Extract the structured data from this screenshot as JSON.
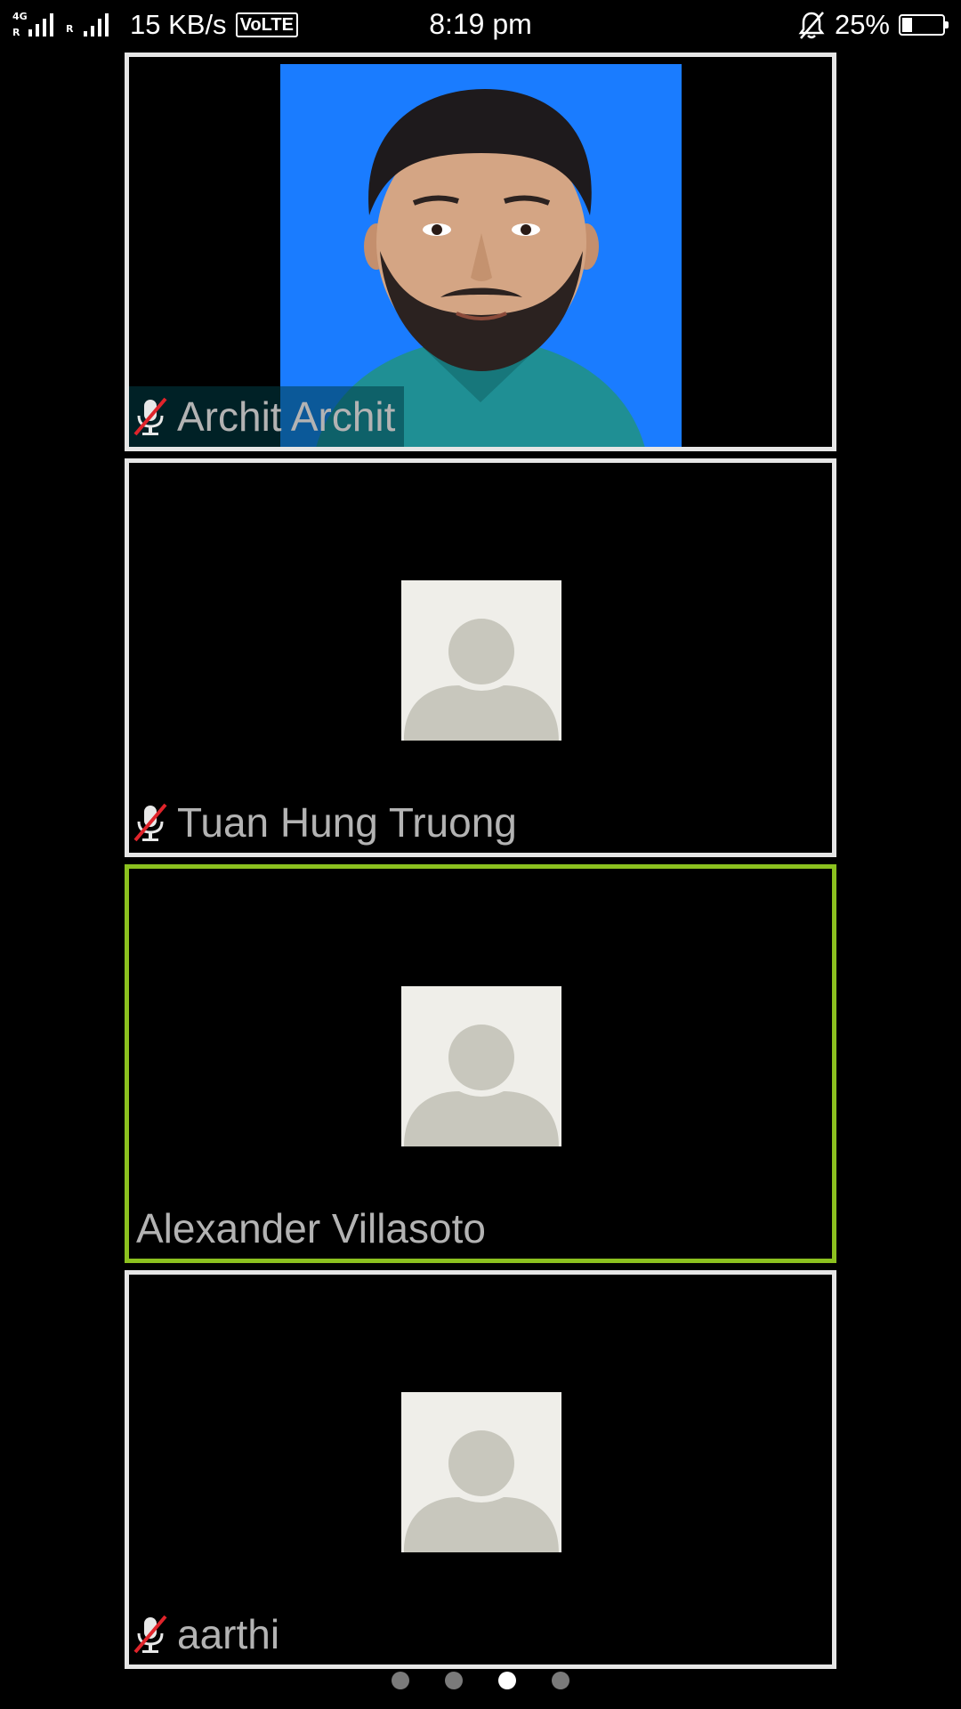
{
  "status_bar": {
    "network_type": "4G",
    "roaming_tag_1": "R",
    "roaming_tag_2": "R",
    "data_speed": "15 KB/s",
    "volte_label": "VoLTE",
    "time": "8:19 pm",
    "notifications_muted_icon": "bell-off-icon",
    "battery_percent": "25%",
    "battery_level": 0.25
  },
  "participants": [
    {
      "name": "Archit Archit",
      "muted": true,
      "has_video": true,
      "active_speaker": false
    },
    {
      "name": "Tuan Hung Truong",
      "muted": true,
      "has_video": false,
      "active_speaker": false
    },
    {
      "name": "Alexander Villasoto",
      "muted": false,
      "has_video": false,
      "active_speaker": true
    },
    {
      "name": "aarthi",
      "muted": true,
      "has_video": false,
      "active_speaker": false
    }
  ],
  "pager": {
    "page_count": 4,
    "current_page": 3
  },
  "colors": {
    "background": "#000000",
    "tile_border": "#e6e6e6",
    "active_speaker_border": "#8cc11f",
    "name_text": "#b3b3b3",
    "placeholder_bg": "#efeee9",
    "placeholder_silhouette": "#c8c7bd",
    "mute_slash": "#e0242b"
  }
}
